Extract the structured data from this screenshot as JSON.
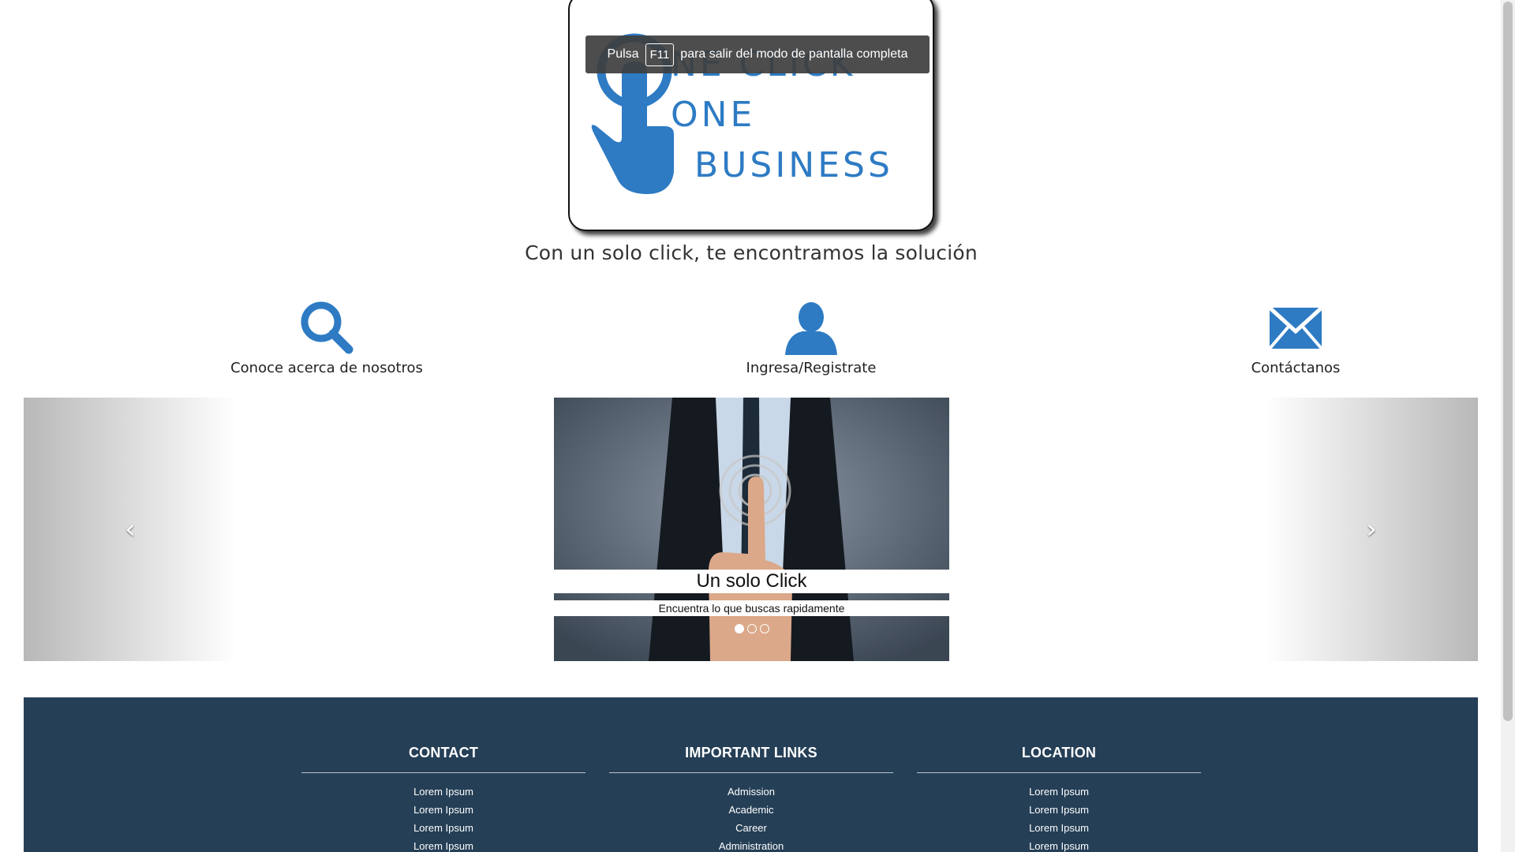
{
  "logo": {
    "line1": "NE CLICK",
    "line2": "ONE",
    "line3": "BUSINESS"
  },
  "fullscreen_notice": {
    "before": "Pulsa",
    "key": "F11",
    "after": "para salir del modo de pantalla completa"
  },
  "tagline": "Con un solo click, te encontramos la solución",
  "features": [
    {
      "label": "Conoce acerca de nosotros",
      "icon": "search-icon"
    },
    {
      "label": "Ingresa/Registrate",
      "icon": "user-icon"
    },
    {
      "label": "Contáctanos",
      "icon": "envelope-icon"
    }
  ],
  "carousel": {
    "prev_icon": "‹",
    "next_icon": "›",
    "caption_title": "Un solo Click",
    "caption_text": "Encuentra lo que buscas rapidamente",
    "slide_count": 3,
    "active_index": 0
  },
  "footer": {
    "columns": [
      {
        "title": "CONTACT",
        "items": [
          "Lorem Ipsum",
          "Lorem Ipsum",
          "Lorem Ipsum",
          "Lorem Ipsum"
        ]
      },
      {
        "title": "IMPORTANT LINKS",
        "items": [
          "Admission",
          "Academic",
          "Career",
          "Administration"
        ]
      },
      {
        "title": "LOCATION",
        "items": [
          "Lorem Ipsum",
          "Lorem Ipsum",
          "Lorem Ipsum",
          "Lorem Ipsum"
        ]
      }
    ]
  },
  "colors": {
    "brand_blue": "#2e7bc4",
    "footer_bg": "#253f56"
  }
}
